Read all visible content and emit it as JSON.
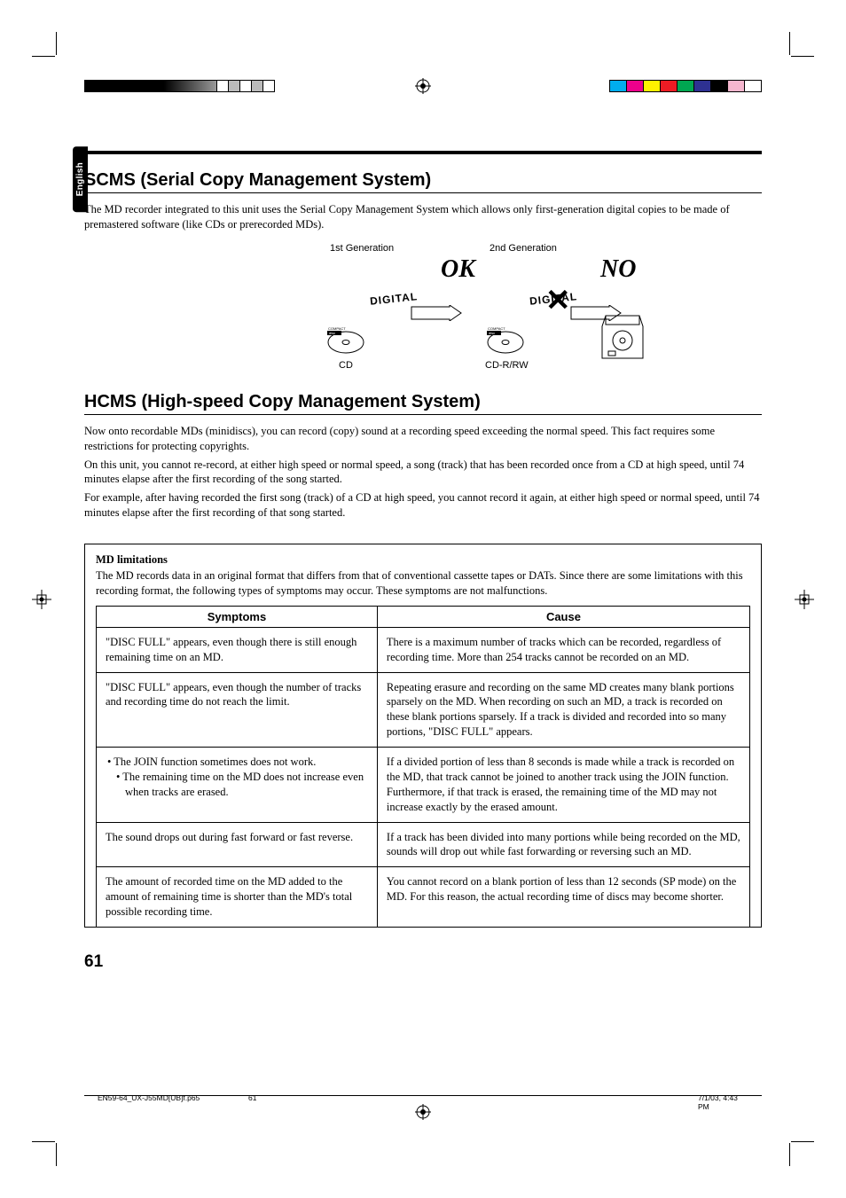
{
  "lang_tab": "English",
  "scms": {
    "heading": "SCMS (Serial Copy Management System)",
    "body": "The MD recorder integrated to this unit uses the Serial Copy Management System which allows only first-generation digital copies to be made of premastered software (like CDs or prerecorded MDs)."
  },
  "diagram": {
    "gen1": "1st Generation",
    "gen2": "2nd Generation",
    "ok": "OK",
    "no": "NO",
    "digital": "DIGITAL",
    "cd": "CD",
    "cdrrw": "CD-R/RW"
  },
  "hcms": {
    "heading": "HCMS (High-speed Copy Management System)",
    "p1": "Now onto recordable MDs (minidiscs), you can record (copy) sound at a recording speed exceeding the normal speed. This fact requires some restrictions for protecting copyrights.",
    "p2": "On this unit, you cannot re-record, at either high speed or normal speed, a song (track) that has been recorded once from a CD at high speed, until 74 minutes elapse after the first recording of the song started.",
    "p3": "For example, after having recorded the first song (track) of a CD at high speed, you cannot record it again, at either high speed or normal speed, until 74 minutes elapse after the first recording of that song started."
  },
  "limitations": {
    "title": "MD limitations",
    "intro": "The MD records data in an original format that differs from that of conventional cassette tapes or DATs. Since there are some limitations with this recording format, the following types of symptoms may occur. These symptoms are not malfunctions.",
    "col_symptoms": "Symptoms",
    "col_cause": "Cause",
    "rows": [
      {
        "symptom": "\"DISC FULL\" appears, even though there is still enough remaining time on an MD.",
        "cause": "There is a maximum number of tracks which can be recorded, regardless of recording time. More than 254 tracks cannot be recorded on an MD."
      },
      {
        "symptom": "\"DISC FULL\" appears, even though the number of tracks and recording time do not reach the limit.",
        "cause": "Repeating erasure and recording on the same MD creates many blank portions sparsely on the MD. When recording on such an MD, a track is recorded on these blank portions sparsely. If a track is divided and recorded into so many portions, \"DISC FULL\" appears."
      },
      {
        "symptom_list": [
          "• The JOIN function sometimes does not work.",
          "• The remaining time on the MD does not increase even when tracks are erased."
        ],
        "cause": "If a divided portion of less than 8 seconds is made while a track is recorded on the MD, that track cannot be joined to another track using the JOIN function. Furthermore, if that track is erased, the remaining time of the MD may not increase exactly by the erased amount."
      },
      {
        "symptom": "The sound drops out during fast forward or fast reverse.",
        "cause": "If a track has been divided into many portions while being recorded on the MD, sounds will drop out while fast forwarding or reversing such an MD."
      },
      {
        "symptom": "The amount of recorded time on the MD added to the amount of remaining time is shorter than the MD's total possible recording time.",
        "cause": "You cannot record on a blank portion of less than 12 seconds (SP mode) on the MD. For this reason, the actual recording time of discs may become shorter."
      }
    ]
  },
  "page_number": "61",
  "footer": {
    "filename": "EN59-64_UX-J55MD[UB]f.p65",
    "page": "61",
    "datetime": "7/1/03, 4:43 PM"
  }
}
